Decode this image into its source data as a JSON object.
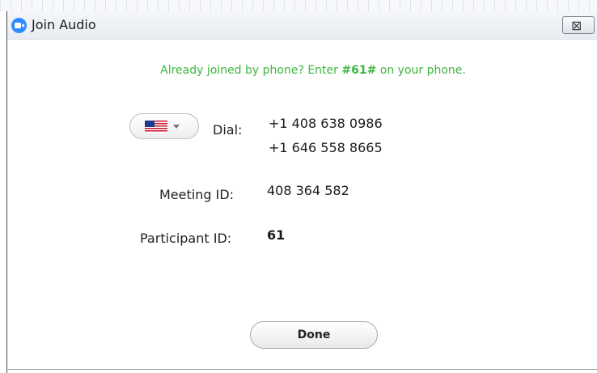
{
  "window": {
    "title": "Join Audio",
    "close_glyph": "⊠"
  },
  "instruction": {
    "prefix": "Already joined by phone? Enter ",
    "code": "#61#",
    "suffix": " on your phone."
  },
  "dial": {
    "country_flag": "us-flag-icon",
    "label": "Dial:",
    "numbers": [
      "+1 408 638 0986",
      "+1 646 558 8665"
    ]
  },
  "meeting": {
    "label": "Meeting ID:",
    "value": "408 364 582"
  },
  "participant": {
    "label": "Participant ID:",
    "value": "61"
  },
  "actions": {
    "done_label": "Done"
  },
  "colors": {
    "instruction_green": "#3db53d",
    "brand_blue": "#2d8cff"
  }
}
